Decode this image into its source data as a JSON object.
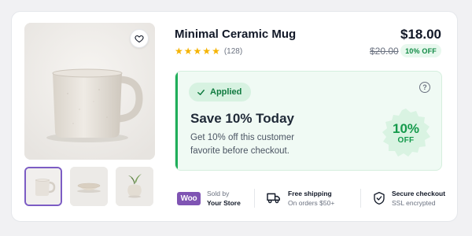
{
  "product": {
    "title": "Minimal Ceramic Mug",
    "price": "$18.00",
    "old_price": "$20.00",
    "discount_pill": "10% OFF",
    "rating": 5,
    "review_count": "(128)"
  },
  "gallery": {
    "main_image": "beige-ceramic-mug",
    "thumbnails": [
      {
        "name": "mug",
        "active": true
      },
      {
        "name": "bowl",
        "active": false
      },
      {
        "name": "vase-with-plant",
        "active": false
      }
    ]
  },
  "promo": {
    "status": "Applied",
    "title": "Save 10% Today",
    "description": "Get 10% off this customer favorite before checkout.",
    "badge_value": "10%",
    "badge_off": "OFF",
    "help": "?"
  },
  "trust": {
    "items": [
      {
        "icon": "woo-logo",
        "logo_text": "Woo",
        "line1": "Sold by",
        "line2": "Your Store"
      },
      {
        "icon": "truck-icon",
        "line1": "Free shipping",
        "line2": "On orders $50+"
      },
      {
        "icon": "shield-check-icon",
        "line1": "Secure checkout",
        "line2": "SSL encrypted"
      }
    ]
  },
  "colors": {
    "accent_green": "#1fae5a",
    "star": "#f5b301",
    "brand_purple": "#7f54b3"
  }
}
